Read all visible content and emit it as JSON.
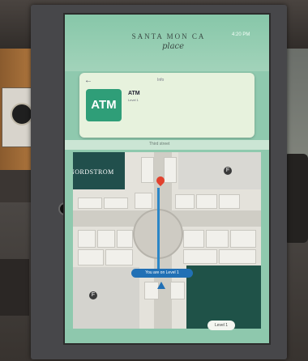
{
  "kiosk": {
    "brand": "SANTA MON CA",
    "brand_script": "place",
    "clock": "4:20 PM"
  },
  "destination_card": {
    "back_icon": "back-arrow-icon",
    "category": "Info",
    "tile_label": "ATM",
    "title": "ATM",
    "subtitle": "Level 1"
  },
  "map": {
    "header_label": "Third street",
    "anchor_store": "NORDSTROM",
    "you_are_here": "You are on Level 1",
    "food_court_label": "F"
  },
  "level_chip": "Level 1"
}
